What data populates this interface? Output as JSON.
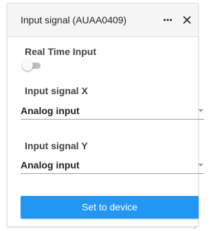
{
  "panel": {
    "title": "Input signal (AUAA0409)",
    "more_icon": "more-horizontal-icon",
    "close_icon": "close-icon"
  },
  "real_time": {
    "label": "Real Time Input",
    "enabled": false
  },
  "signal_x": {
    "label": "Input signal X",
    "value": "Analog input"
  },
  "signal_y": {
    "label": "Input signal Y",
    "value": "Analog input"
  },
  "action": {
    "label": "Set to device"
  },
  "colors": {
    "accent": "#2196f3",
    "header_bg": "#f5f5f5",
    "toggle_track_off": "#bdbdbd"
  }
}
